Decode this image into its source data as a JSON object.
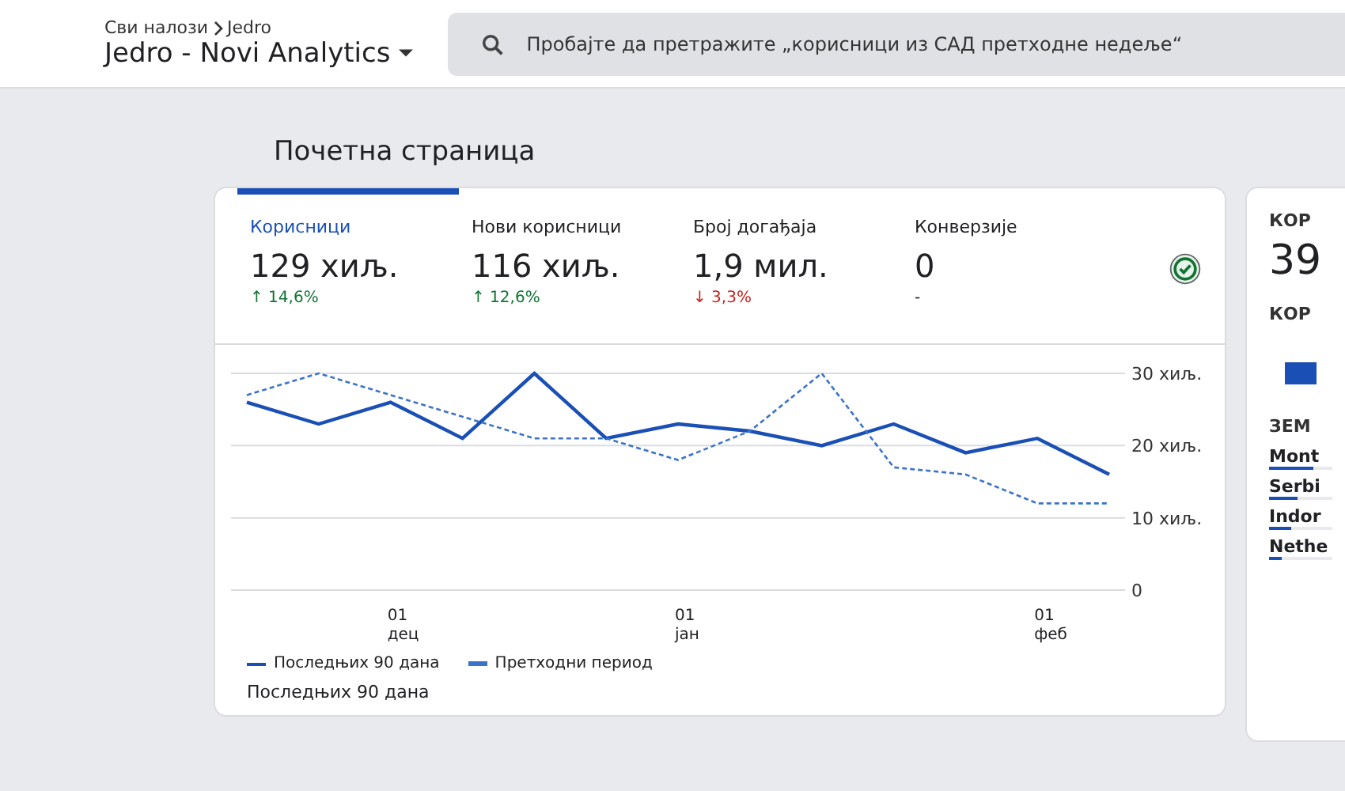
{
  "header": {
    "breadcrumb": [
      "Сви налози",
      "Jedro"
    ],
    "property": "Jedro - Novi Analytics",
    "search": {
      "placeholder": "Пробајте да претражите „корисници из САД претходне недеље“"
    }
  },
  "page_title": "Почетна страница",
  "overview_card": {
    "metrics": [
      {
        "label": "Корисници",
        "value": "129 хиљ.",
        "change": "↑ 14,6%",
        "color": "#137333",
        "selected": true
      },
      {
        "label": "Нови корисници",
        "value": "116 хиљ.",
        "change": "↑ 12,6%",
        "color": "#137333",
        "selected": false
      },
      {
        "label": "Број догађаја",
        "value": "1,9 мил.",
        "change": "↓ 3,3%",
        "color": "#c5221f",
        "selected": false
      },
      {
        "label": "Конверзије",
        "value": "0",
        "change": "-",
        "color": "#202124",
        "selected": false
      }
    ],
    "chart_data": {
      "type": "line",
      "categories": [
        null,
        null,
        "01 дец",
        null,
        null,
        null,
        "01 јан",
        null,
        null,
        null,
        null,
        "01 феб",
        null
      ],
      "series": [
        {
          "name": "Последњих 90 дана",
          "color": "#1a4fb5",
          "line_style": "solid",
          "values": [
            26,
            23,
            26,
            21,
            30,
            21,
            23,
            22,
            20,
            23,
            19,
            21,
            16
          ]
        },
        {
          "name": "Претходни период",
          "color": "#3b73c9",
          "line_style": "dashed",
          "values": [
            27,
            30,
            27,
            24,
            21,
            21,
            18,
            22,
            30,
            17,
            16,
            12,
            12
          ]
        }
      ],
      "grid": true,
      "ylim": [
        0,
        30
      ],
      "yticks": [
        {
          "value": 0,
          "label": "0"
        },
        {
          "value": 10,
          "label": "10 хиљ."
        },
        {
          "value": 20,
          "label": "20 хиљ."
        },
        {
          "value": 30,
          "label": "30 хиљ."
        }
      ]
    },
    "footer_text": "Последњих 90 дана"
  },
  "side_card": {
    "title": "КОР",
    "value": "39",
    "subtitle": "КОР",
    "section": "ЗЕМ",
    "rows": [
      {
        "name": "Mont",
        "level": 0.7
      },
      {
        "name": "Serbi",
        "level": 0.45
      },
      {
        "name": "Indor",
        "level": 0.35
      },
      {
        "name": "Nethe",
        "level": 0.2
      }
    ]
  }
}
